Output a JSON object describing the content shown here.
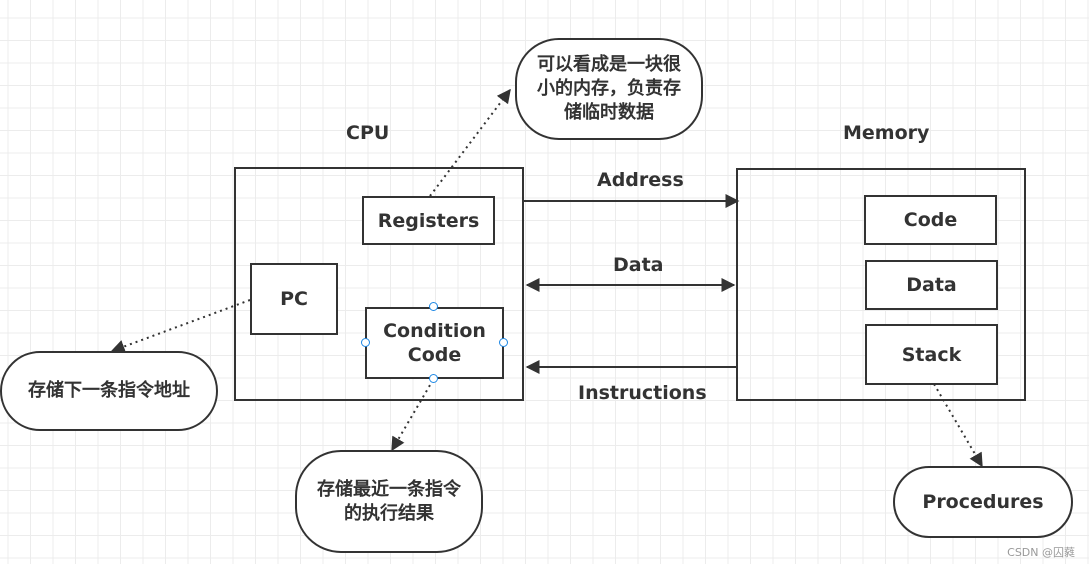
{
  "cpu": {
    "title": "CPU",
    "components": {
      "registers": "Registers",
      "pc": "PC",
      "condition_code": "Condition Code"
    }
  },
  "memory": {
    "title": "Memory",
    "segments": [
      "Code",
      "Data",
      "Stack"
    ]
  },
  "buses": {
    "address": "Address",
    "data": "Data",
    "instructions": "Instructions"
  },
  "notes": {
    "registers": "可以看成是一块很小的内存，负责存储临时数据",
    "registers_lines": [
      "可以看成是一块很",
      "小的内存，负责存",
      "储临时数据"
    ],
    "pc": "存储下一条指令地址",
    "condition_code_lines": [
      "存储最近一条指令",
      "的执行结果"
    ],
    "procedures": "Procedures"
  },
  "watermark": "CSDN @囚蕤",
  "colors": {
    "stroke": "#333333",
    "handle": "#1e88e5",
    "grid": "#ececec"
  }
}
